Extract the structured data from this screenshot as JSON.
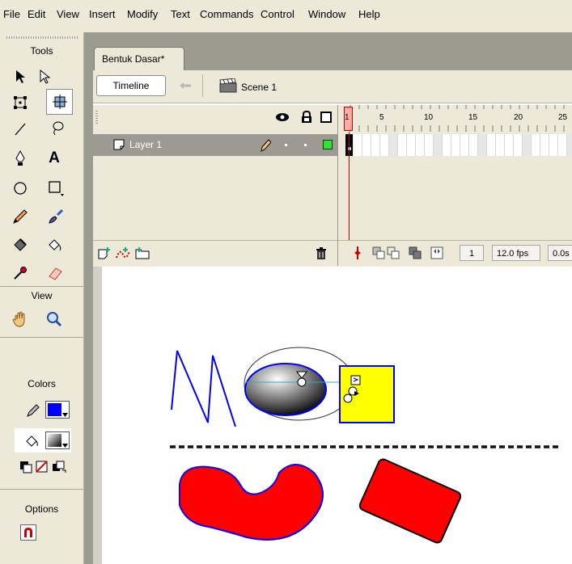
{
  "menu": [
    "File",
    "Edit",
    "View",
    "Insert",
    "Modify",
    "Text",
    "Commands",
    "Control",
    "Window",
    "Help"
  ],
  "tools_panel": {
    "title": "Tools",
    "view_title": "View",
    "colors_title": "Colors",
    "options_title": "Options",
    "stroke_color": "#0000ff",
    "fill_color": "gradient"
  },
  "document": {
    "tab_label": "Bentuk Dasar*",
    "timeline_button": "Timeline",
    "scene_label": "Scene 1"
  },
  "timeline": {
    "layer_name": "Layer 1",
    "ruler_labels": [
      "1",
      "5",
      "10",
      "15",
      "20",
      "25"
    ],
    "current_frame": "1",
    "frame_rate": "12.0 fps",
    "elapsed": "0.0s"
  },
  "colors": {
    "stroke_blue": "#0000ff",
    "fill_red": "#ff0000",
    "fill_yellow": "#ffff00",
    "playhead": "#cc0000"
  }
}
